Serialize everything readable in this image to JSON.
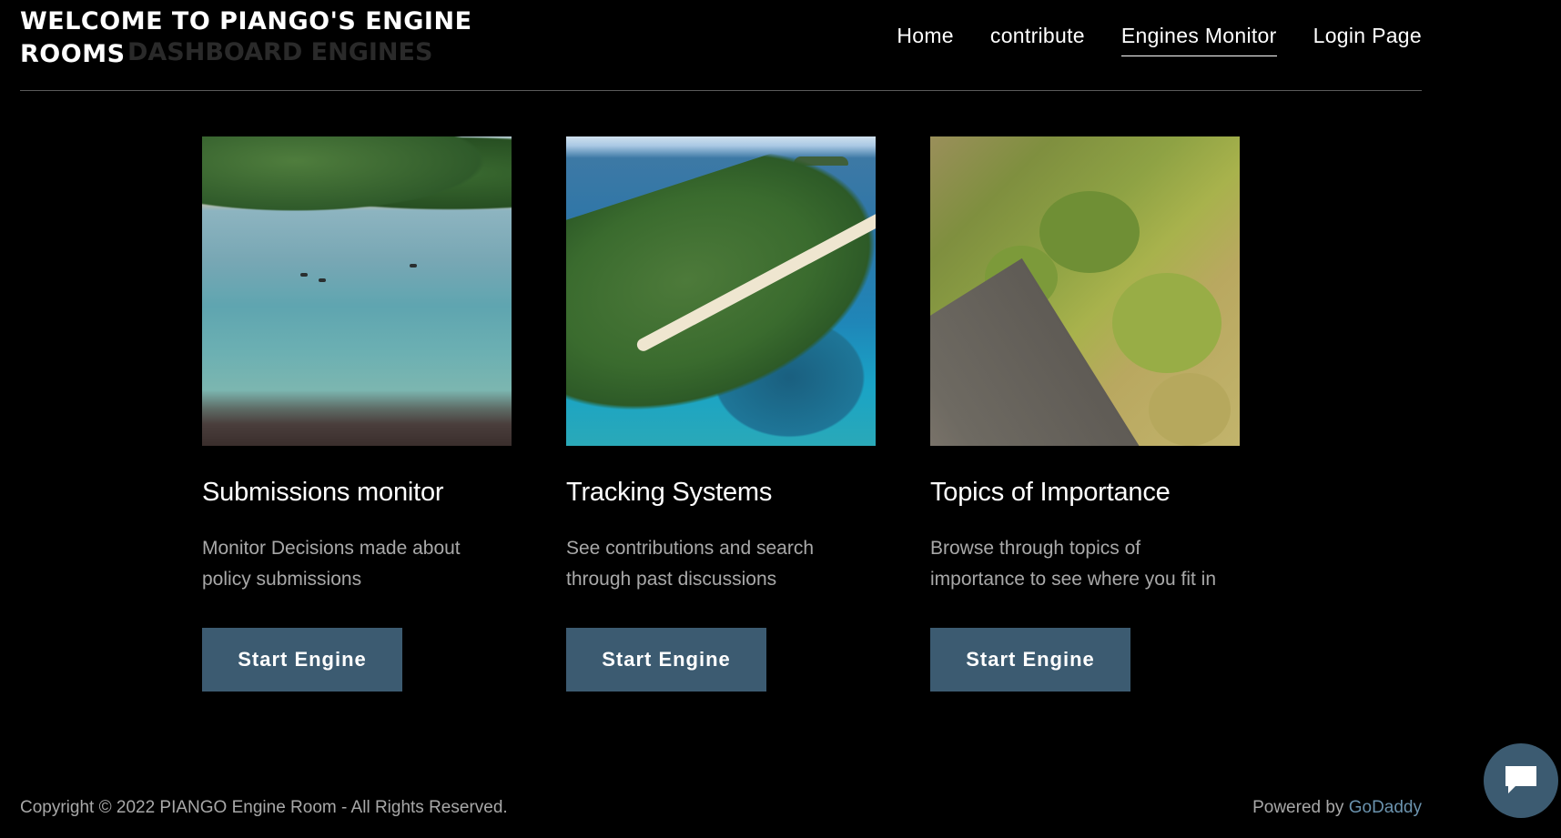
{
  "header": {
    "title": "WELCOME TO PIANGO'S ENGINE ROOMS",
    "ghost_title": "DASHBOARD ENGINES",
    "nav": [
      {
        "label": "Home",
        "active": false
      },
      {
        "label": "contribute",
        "active": false
      },
      {
        "label": "Engines Monitor",
        "active": true
      },
      {
        "label": "Login Page",
        "active": false
      }
    ]
  },
  "cards": [
    {
      "image": "aerial lagoon photo",
      "title": "Submissions monitor",
      "description": "Monitor Decisions made about policy submissions",
      "button_label": "Start Engine"
    },
    {
      "image": "aerial island photo",
      "title": "Tracking Systems",
      "description": "See contributions and search through past discussions",
      "button_label": "Start Engine"
    },
    {
      "image": "aerial grass and road photo",
      "title": "Topics of Importance",
      "description": "Browse through topics of importance to see where you fit in",
      "button_label": "Start Engine"
    }
  ],
  "footer": {
    "copyright": "Copyright © 2022 PIANGO Engine Room - All Rights Reserved.",
    "powered_prefix": "Powered by ",
    "powered_link": "GoDaddy"
  },
  "chat": {
    "icon": "chat-bubble-icon"
  },
  "colors": {
    "background": "#000000",
    "button": "#3c5b71",
    "link": "#6b93ae",
    "muted_text": "#a8a8a8"
  }
}
